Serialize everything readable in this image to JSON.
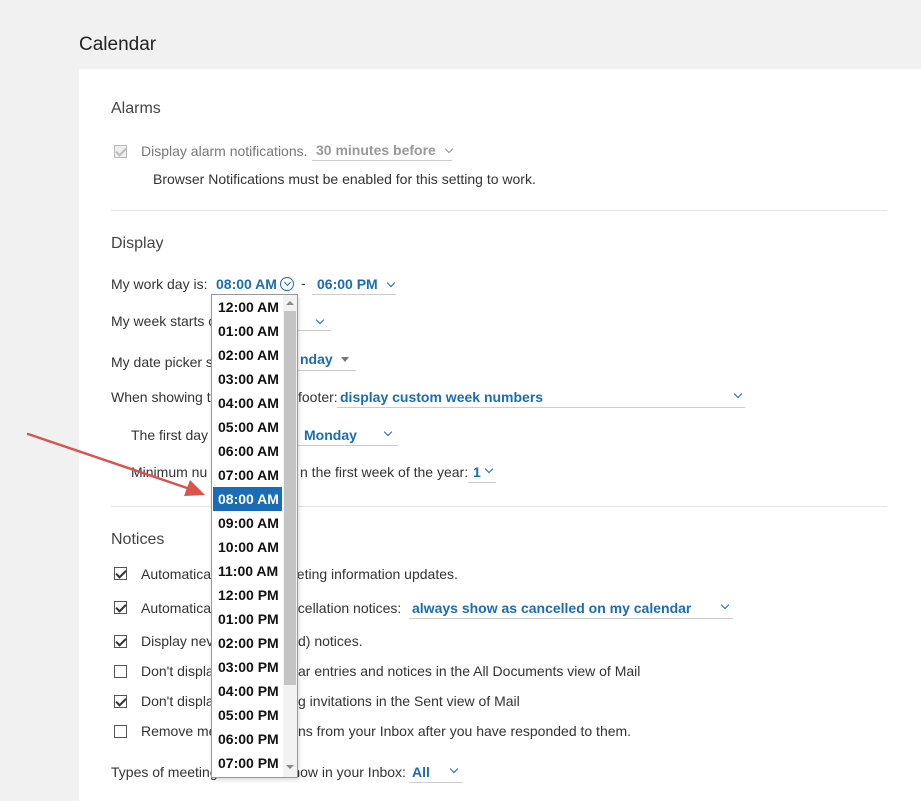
{
  "page": {
    "title": "Calendar"
  },
  "alarms": {
    "title": "Alarms",
    "display_alarm_label": "Display alarm notifications.",
    "display_alarm_value": "30 minutes before",
    "browser_note": "Browser Notifications must be enabled for this setting to work."
  },
  "display": {
    "title": "Display",
    "work_day_label": "My work day is:",
    "work_day_start": "08:00 AM",
    "work_day_sep": "-",
    "work_day_end": "06:00 PM",
    "week_starts_label": "My week starts o",
    "date_picker_label": "My date picker s",
    "date_picker_value": "nday",
    "when_showing_label": "When showing t",
    "footer_label": "footer:",
    "week_numbers_value": "display custom week numbers",
    "first_day_label": "The first day",
    "first_day_value": "Monday",
    "min_num_label": "Minimum nu",
    "min_num_label_tail": "n the first week of the year:",
    "min_num_value": "1"
  },
  "notices": {
    "title": "Notices",
    "items": [
      {
        "left": "Automatica",
        "right": "eeting information updates.",
        "checked": true
      },
      {
        "left": "Automatica",
        "right": "ncellation notices:",
        "checked": true,
        "select": "always show as cancelled on my calendar"
      },
      {
        "left": "Display nev",
        "right": "d) notices.",
        "checked": true
      },
      {
        "left": "Don't displa",
        "right": "ar entries and notices in the All Documents view of Mail",
        "checked": false
      },
      {
        "left": "Don't displa",
        "right": "g invitations in the Sent view of Mail",
        "checked": true
      },
      {
        "left": "Remove me",
        "right": "ns from your Inbox after you have responded to them.",
        "checked": false
      }
    ],
    "types_label": "Types of meeting notices to show in your Inbox:",
    "types_value": "All"
  },
  "time_dropdown": {
    "selected": "08:00 AM",
    "options": [
      "12:00 AM",
      "01:00 AM",
      "02:00 AM",
      "03:00 AM",
      "04:00 AM",
      "05:00 AM",
      "06:00 AM",
      "07:00 AM",
      "08:00 AM",
      "09:00 AM",
      "10:00 AM",
      "11:00 AM",
      "12:00 PM",
      "01:00 PM",
      "02:00 PM",
      "03:00 PM",
      "04:00 PM",
      "05:00 PM",
      "06:00 PM",
      "07:00 PM"
    ]
  },
  "colors": {
    "accent": "#1a6cb7",
    "annotation_arrow": "#d9534f"
  }
}
